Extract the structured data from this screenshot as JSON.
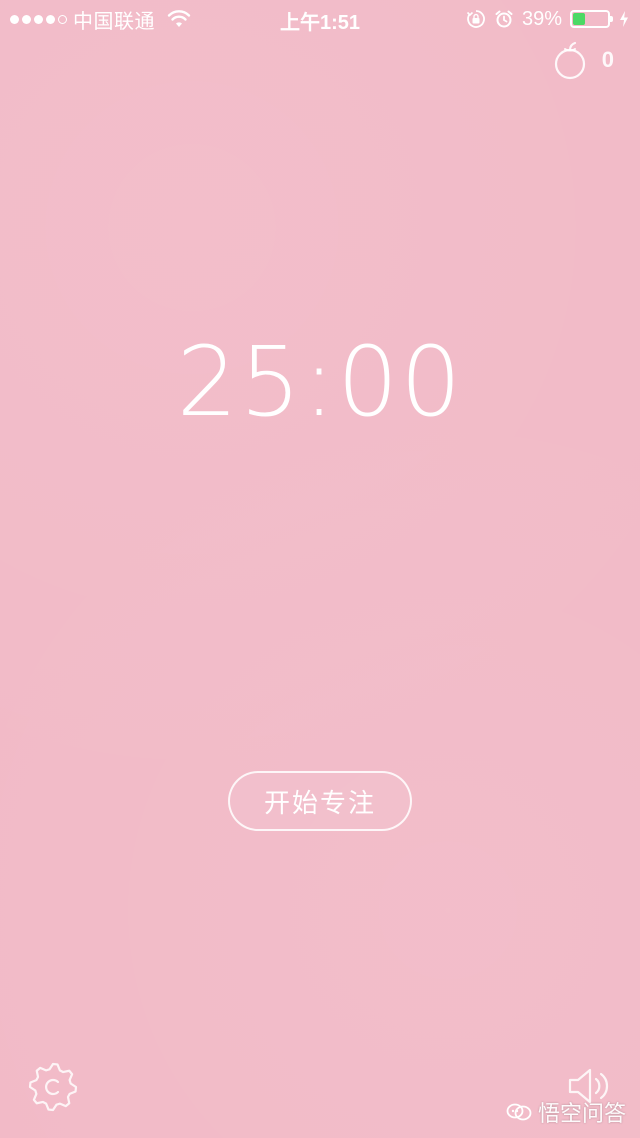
{
  "status_bar": {
    "carrier": "中国联通",
    "time": "上午1:51",
    "battery_percent_text": "39%",
    "battery_level": 0.39,
    "signal_bars_filled": 4,
    "signal_bars_total": 5,
    "icons": [
      "wifi-icon",
      "orientation-lock-icon",
      "alarm-icon",
      "battery-icon",
      "charging-icon"
    ]
  },
  "header": {
    "tomato_count": "0",
    "tomato_icon": "tomato-icon"
  },
  "timer": {
    "display": "25:00"
  },
  "actions": {
    "start_label": "开始专注"
  },
  "footer": {
    "settings_icon": "gear-icon",
    "sound_icon": "speaker-icon"
  },
  "watermark": {
    "text": "悟空问答"
  },
  "colors": {
    "background": "#f2bac7",
    "foreground": "#ffffff",
    "battery_fill": "#4cd964"
  }
}
